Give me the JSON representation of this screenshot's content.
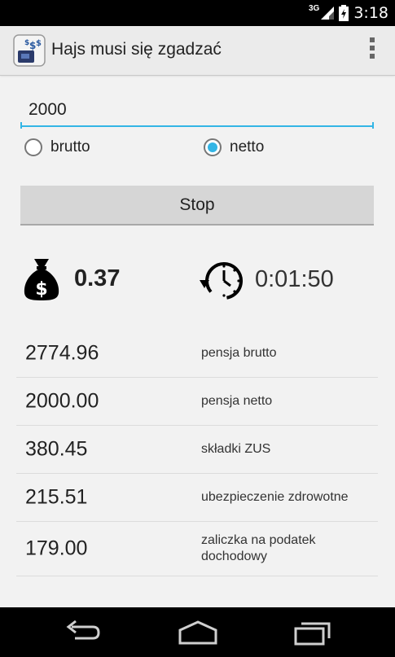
{
  "status_bar": {
    "network": "3G",
    "time": "3:18"
  },
  "app": {
    "title": "Hajs musi się zgadzać"
  },
  "form": {
    "amount_value": "2000",
    "radio_options": [
      {
        "label": "brutto",
        "checked": false
      },
      {
        "label": "netto",
        "checked": true
      }
    ],
    "stop_label": "Stop"
  },
  "summary": {
    "earned": "0.37",
    "elapsed": "0:01:50"
  },
  "results": [
    {
      "value": "2774.96",
      "label": "pensja brutto"
    },
    {
      "value": "2000.00",
      "label": "pensja netto"
    },
    {
      "value": "380.45",
      "label": "składki ZUS"
    },
    {
      "value": "215.51",
      "label": "ubezpieczenie zdrowotne"
    },
    {
      "value": "179.00",
      "label": "zaliczka na podatek dochodowy"
    }
  ],
  "colors": {
    "accent": "#33b5e5",
    "status_bar": "#000000",
    "action_bar": "#ebebeb",
    "background": "#f2f2f2"
  },
  "icons": [
    "signal-icon",
    "battery-icon",
    "app-icon",
    "overflow-menu-icon",
    "money-bag-icon",
    "timer-icon",
    "back-icon",
    "home-icon",
    "recent-apps-icon"
  ]
}
